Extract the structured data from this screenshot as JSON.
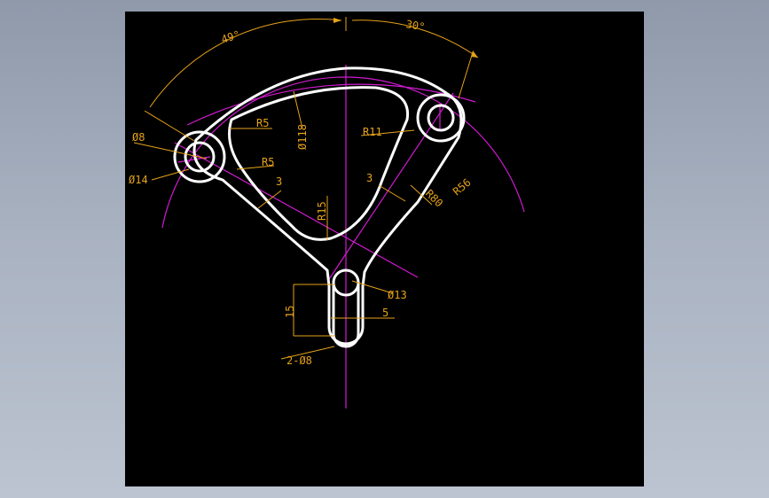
{
  "drawing": {
    "colors": {
      "background": "#000000",
      "part_outline": "#ffffff",
      "center_lines": "#d01ad0",
      "dimensions": "#e6a21a",
      "window_gradient": "#a8b1c0"
    },
    "dimensions": {
      "angle_left": "49°",
      "angle_right": "30°",
      "dia_8": "Ø8",
      "dia_14": "Ø14",
      "radius_5_top": "R5",
      "radius_5_bottom": "R5",
      "dim_3_left": "3",
      "dia_118": "Ø118",
      "radius_15": "R15",
      "radius_11": "R11",
      "dim_3_right": "3",
      "radius_80": "R80",
      "radius_56": "R56",
      "dia_13": "Ø13",
      "dim_15": "15",
      "dim_5": "5",
      "holes_2x8": "2-Ø8"
    }
  }
}
